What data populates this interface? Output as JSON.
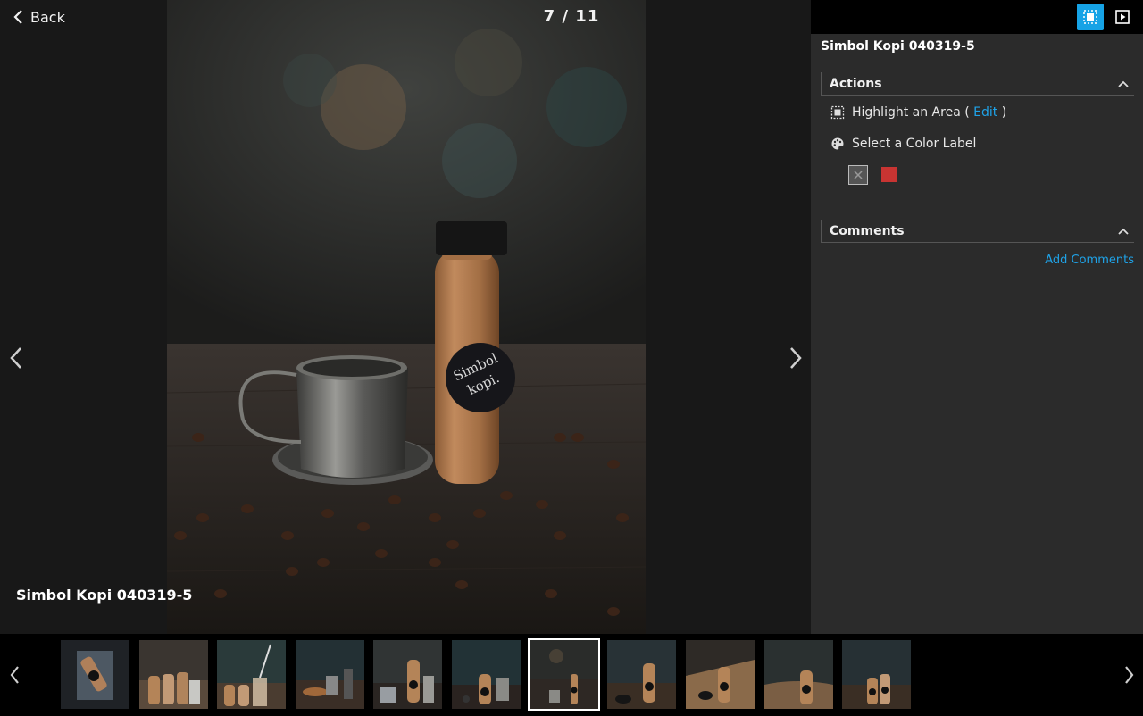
{
  "topbar": {
    "back_label": "Back",
    "counter": "7 / 11"
  },
  "viewer": {
    "caption": "Simbol Kopi 040319-5",
    "bottle_label_line1": "Simbol",
    "bottle_label_line2": "kopi."
  },
  "panel": {
    "title": "Simbol Kopi 040319-5",
    "actions": {
      "header": "Actions",
      "highlight_label": "Highlight an Area (",
      "edit_link": "Edit",
      "highlight_close": ")",
      "color_label": "Select a Color Label",
      "swatch_color": "#c83432"
    },
    "comments": {
      "header": "Comments",
      "add_link": "Add Comments"
    }
  },
  "filmstrip": {
    "count": 11,
    "selected_index": 7
  },
  "colors": {
    "accent": "#16a3e6",
    "link": "#1fa3e8",
    "panel_bg": "#2b2b2b"
  },
  "icons": [
    "chevron-left-icon",
    "chevron-right-icon",
    "select-area-icon",
    "slideshow-icon",
    "chevron-up-icon",
    "palette-icon",
    "no-color-icon"
  ]
}
